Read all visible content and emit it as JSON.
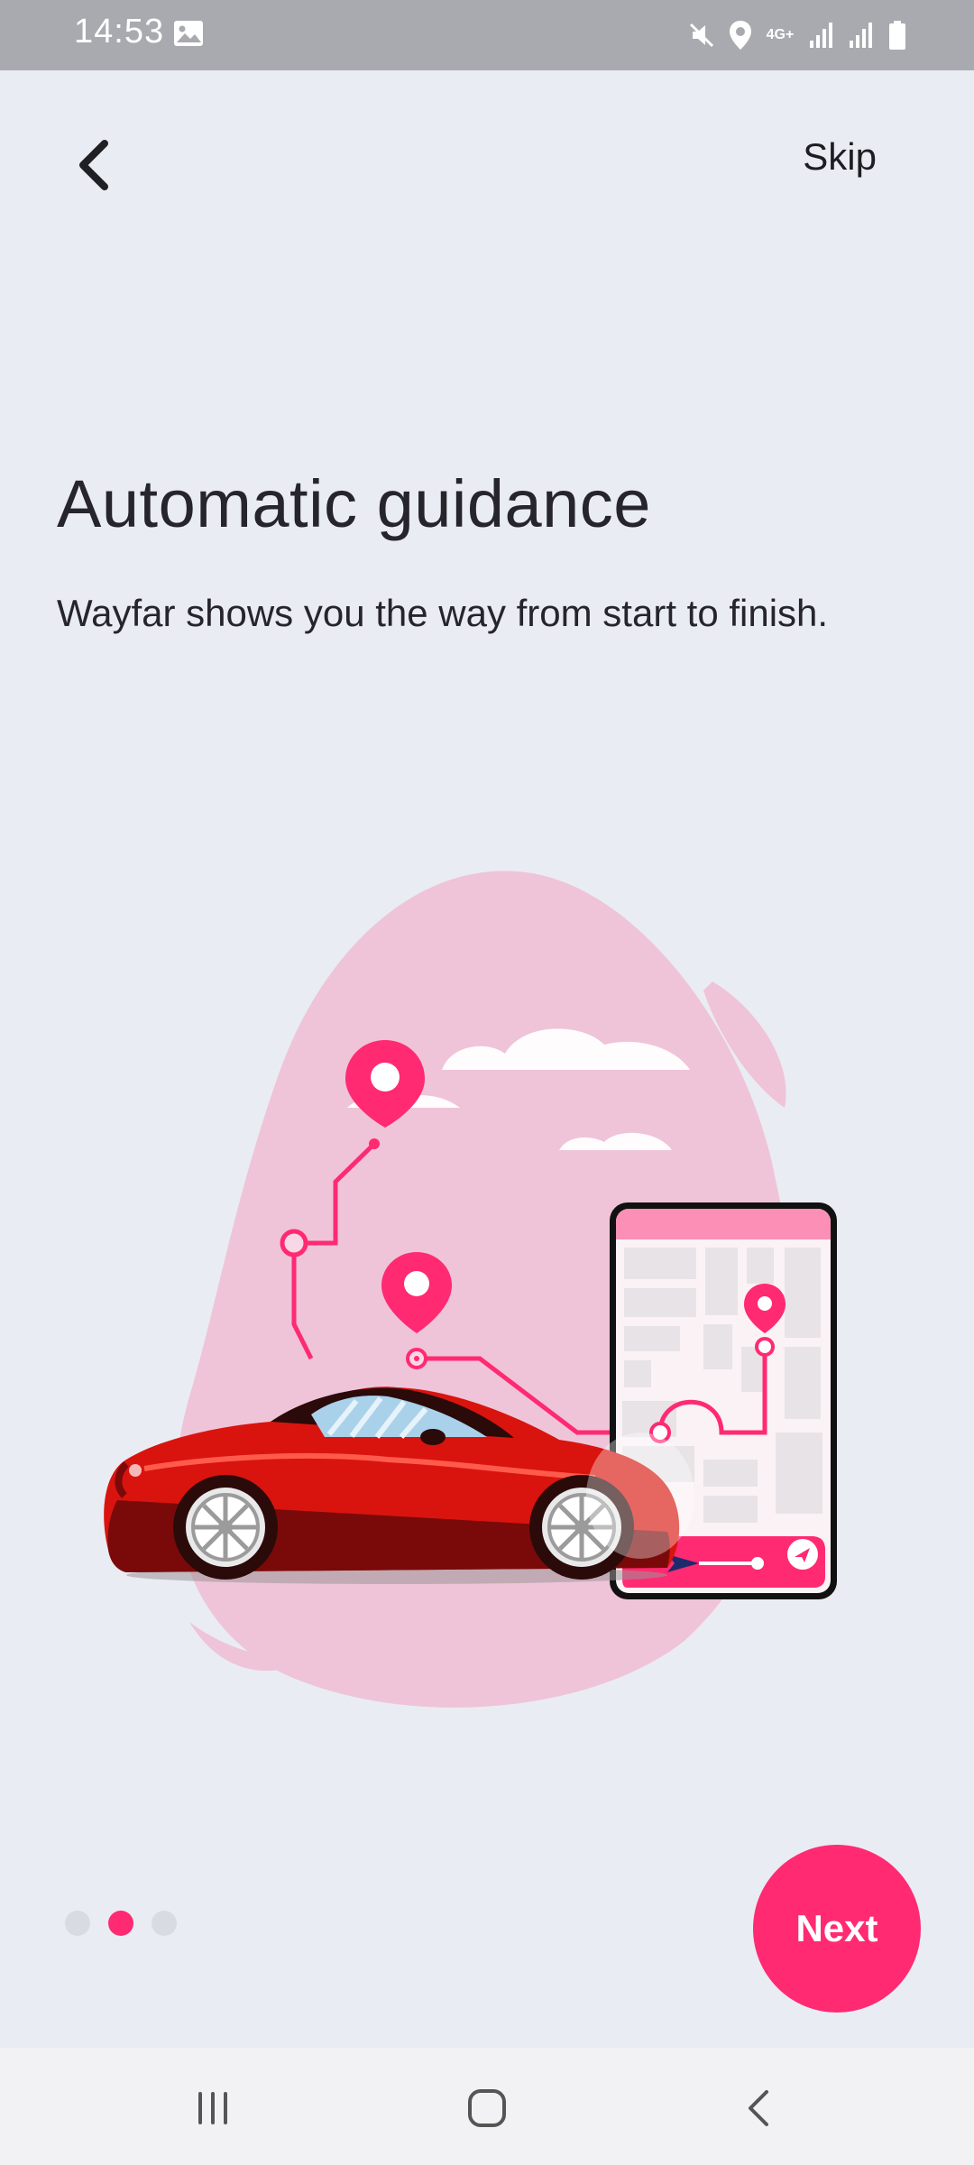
{
  "status_bar": {
    "time": "14:53",
    "network": "4G+",
    "icons": [
      "gallery-icon",
      "mute-icon",
      "location-icon",
      "network-4g-icon",
      "signal-icon",
      "signal-icon",
      "battery-icon"
    ]
  },
  "header": {
    "back_icon": "chevron-left-icon",
    "skip_label": "Skip"
  },
  "onboarding": {
    "title": "Automatic guidance",
    "subtitle": "Wayfar shows you the way from start to finish.",
    "current_page": 2,
    "total_pages": 3,
    "next_label": "Next"
  },
  "colors": {
    "background": "#eaecf3",
    "accent": "#ff2a72",
    "blob": "#efc4d8",
    "car": "#d9140f",
    "dot_inactive": "#d9dbe2"
  },
  "nav_bar": {
    "icons": [
      "recent-apps-icon",
      "home-icon",
      "back-icon"
    ]
  }
}
